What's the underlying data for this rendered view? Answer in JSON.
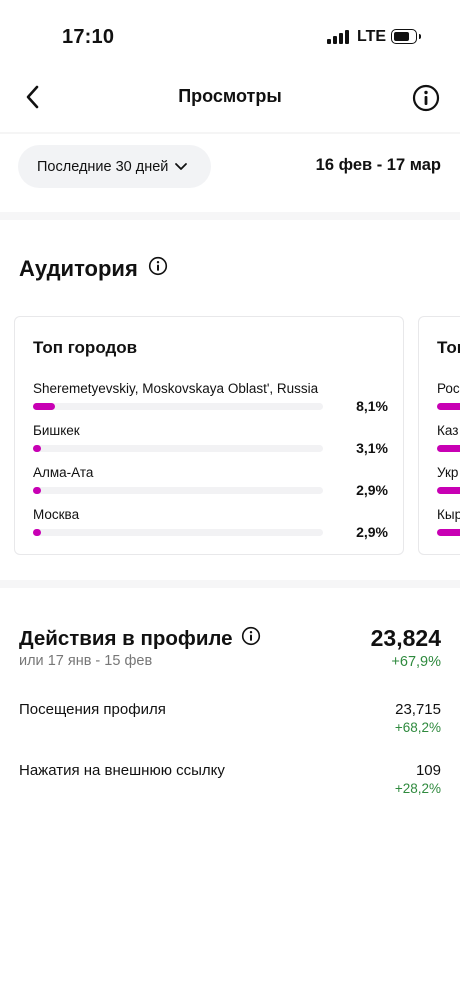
{
  "status_bar": {
    "time": "17:10",
    "network": "LTE"
  },
  "header": {
    "title": "Просмотры",
    "back_icon": "chevron-left-icon",
    "info_icon": "info-icon"
  },
  "date_filter": {
    "selected": "Последние 30 дней",
    "range": "16 фев - 17 мар"
  },
  "audience": {
    "title": "Аудитория",
    "cards": [
      {
        "title": "Топ городов",
        "rows": [
          {
            "name": "Sheremetyevskiy, Moskovskaya Oblast', Russia",
            "percent": "8,1%",
            "value": 8.1
          },
          {
            "name": "Бишкек",
            "percent": "3,1%",
            "value": 3.1
          },
          {
            "name": "Алма-Ата",
            "percent": "2,9%",
            "value": 2.9
          },
          {
            "name": "Москва",
            "percent": "2,9%",
            "value": 2.9
          }
        ]
      },
      {
        "title": "Топ",
        "rows": [
          {
            "name": "Рос"
          },
          {
            "name": "Каз"
          },
          {
            "name": "Укр"
          },
          {
            "name": "Кыр"
          }
        ]
      }
    ]
  },
  "profile_actions": {
    "title": "Действия в профиле",
    "compare_period": "или 17 янв - 15 фев",
    "total": "23,824",
    "total_change": "+67,9%",
    "metrics": [
      {
        "label": "Посещения профиля",
        "value": "23,715",
        "change": "+68,2%"
      },
      {
        "label": "Нажатия на внешнюю ссылку",
        "value": "109",
        "change": "+28,2%"
      }
    ]
  },
  "colors": {
    "accent_bar": "#c800b4",
    "positive": "#2f8a3e"
  }
}
